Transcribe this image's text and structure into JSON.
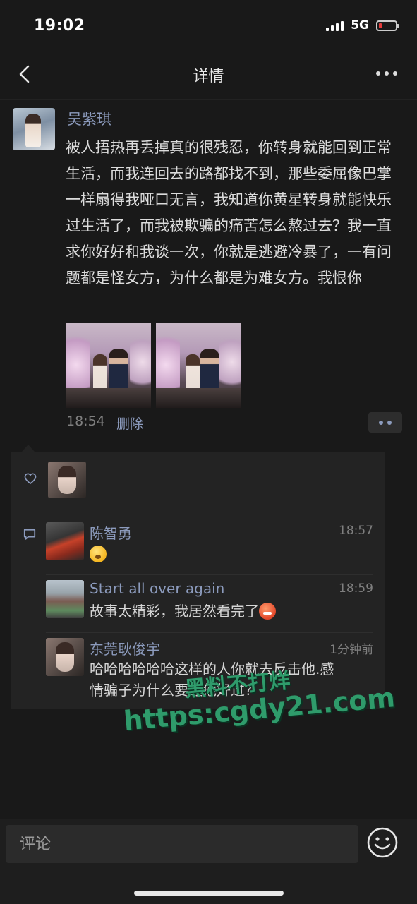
{
  "status_bar": {
    "time": "19:02",
    "network": "5G",
    "signal_bars": 4,
    "battery_level": 0.1
  },
  "nav": {
    "title": "详情"
  },
  "post": {
    "author": "吴紫琪",
    "text": "被人捂热再丢掉真的很残忍，你转身就能回到正常生活，而我连回去的路都找不到，那些委屈像巴掌一样扇得我哑口无言，我知道你黄星转身就能快乐过生活了，而我被欺骗的痛苦怎么熬过去？我一直求你好好和我谈一次，你就是逃避冷暴了，一有问题都是怪女方，为什么都是为难女方。我恨你",
    "photos_count": 2,
    "time": "18:54",
    "delete_label": "删除"
  },
  "comments": [
    {
      "name": "陈智勇",
      "time": "18:57",
      "text": "",
      "emoji": "yellow-face"
    },
    {
      "name": "Start all over again",
      "time": "18:59",
      "text": "故事太精彩，我居然看完了",
      "emoji": "red-face"
    },
    {
      "name": "东莞耿俊宇",
      "time": "1分钟前",
      "text_line1": "哈哈哈哈哈哈这样的人你就去反击他.感",
      "text_line2": "情骗子为什么要让他好过?"
    }
  ],
  "watermark": {
    "line1": "黑料不打烊",
    "line2": "https:cgdy21.com"
  },
  "bottom": {
    "comment_placeholder": "评论"
  },
  "colors": {
    "link": "#8c9bbd",
    "background": "#191919",
    "watermark": "#2f9b6b"
  }
}
